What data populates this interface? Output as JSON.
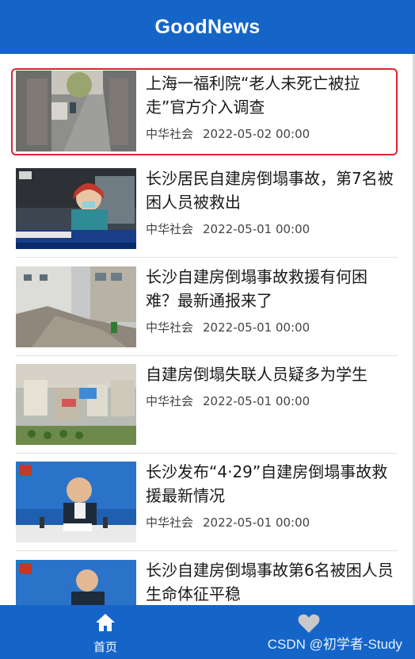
{
  "header": {
    "title": "GoodNews"
  },
  "news": [
    {
      "title": "上海一福利院“老人未死亡被拉走”官方介入调查",
      "source": "中华社会",
      "time": "2022-05-02 00:00",
      "thumb_icon": "blurred-street-photo"
    },
    {
      "title": "长沙居民自建房倒塌事故，第7名被困人员被救出",
      "source": "中华社会",
      "time": "2022-05-01 00:00",
      "thumb_icon": "tv-news-reporter-photo"
    },
    {
      "title": "长沙自建房倒塌事故救援有何困难？最新通报来了",
      "source": "中华社会",
      "time": "2022-05-01 00:00",
      "thumb_icon": "collapsed-building-photo"
    },
    {
      "title": "自建房倒塌失联人员疑多为学生",
      "source": "中华社会",
      "time": "2022-05-01 00:00",
      "thumb_icon": "aerial-rescue-site-photo"
    },
    {
      "title": "长沙发布“4·29”自建房倒塌事故救援最新情况",
      "source": "中华社会",
      "time": "2022-05-01 00:00",
      "thumb_icon": "press-conference-photo"
    },
    {
      "title": "长沙自建房倒塌事故第6名被困人员生命体征平稳",
      "source": "",
      "time": "",
      "thumb_icon": "press-conference-photo"
    }
  ],
  "tabbar": {
    "home": {
      "label": "首页",
      "icon": "home-icon"
    },
    "fav": {
      "label": "",
      "icon": "heart-icon"
    }
  },
  "watermark": "CSDN @初学者-Study",
  "colors": {
    "primary": "#1565c8",
    "highlight": "#e0242b"
  }
}
